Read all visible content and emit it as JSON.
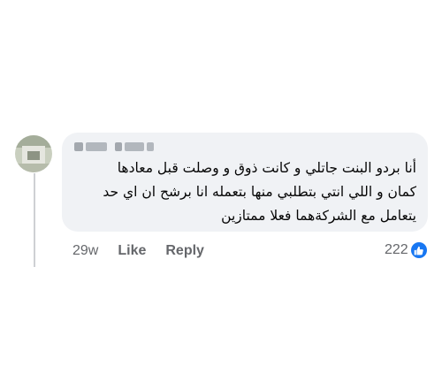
{
  "comment": {
    "lines": [
      "أنا بردو البنت جاتلي و كانت ذوق و وصلت قبل معادها",
      "كمان و اللي انتي بتطلبي منها بتعمله انا برشح ان اي حد",
      "يتعامل مع الشركةهما فعلا ممتازين"
    ]
  },
  "actions": {
    "time": "29w",
    "like_label": "Like",
    "reply_label": "Reply"
  },
  "reactions": {
    "count": "222",
    "icon": "thumbs-up-icon",
    "color": "#1877f2"
  },
  "colors": {
    "bubble": "#f0f2f5",
    "text": "#050505",
    "meta": "#65676b"
  }
}
